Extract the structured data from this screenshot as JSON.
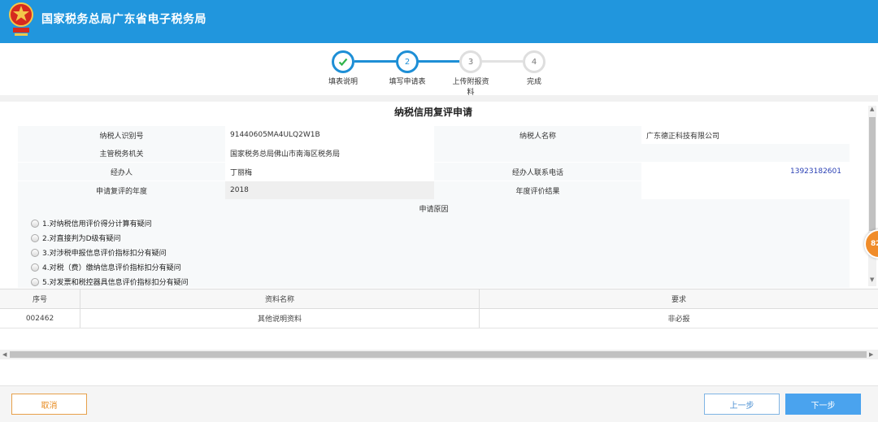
{
  "header": {
    "title": "国家税务总局广东省电子税务局",
    "emblem_icon": "tax-emblem-icon"
  },
  "stepper": {
    "steps": [
      {
        "number": "✓",
        "label": "填表说明",
        "state": "done"
      },
      {
        "number": "2",
        "label": "填写申请表",
        "state": "active"
      },
      {
        "number": "3",
        "label": "上传附报资料",
        "state": "pending"
      },
      {
        "number": "4",
        "label": "完成",
        "state": "pending"
      }
    ]
  },
  "form": {
    "title": "纳税信用复评申请",
    "taxpayer_id_label": "纳税人识别号",
    "taxpayer_id_value": "91440605MA4ULQ2W1B",
    "taxpayer_name_label": "纳税人名称",
    "taxpayer_name_value": "广东德正科技有限公司",
    "authority_label": "主管税务机关",
    "authority_value": "国家税务总局佛山市南海区税务局",
    "handler_label": "经办人",
    "handler_value": "丁丽梅",
    "handler_phone_label": "经办人联系电话",
    "handler_phone_value": "13923182601",
    "year_label": "申请复评的年度",
    "year_value": "2018",
    "result_label": "年度评价结果",
    "result_value": "",
    "reason_label": "申请原因",
    "reasons": [
      "1.对纳税信用评价得分计算有疑问",
      "2.对直接判为D级有疑问",
      "3.对涉税申报信息评价指标扣分有疑问",
      "4.对税（费）缴纳信息评价指标扣分有疑问",
      "5.对发票和税控器具信息评价指标扣分有疑问"
    ]
  },
  "badge": {
    "text": "82"
  },
  "table": {
    "headers": [
      "序号",
      "资料名称",
      "要求"
    ],
    "rows": [
      [
        "002462",
        "其他说明资料",
        "非必报"
      ]
    ]
  },
  "footer": {
    "cancel": "取消",
    "prev": "上一步",
    "next": "下一步"
  },
  "colors": {
    "header": "#2196dd",
    "accent": "#1e8fd6",
    "cancel": "#e78a1e",
    "next": "#4aa3ee",
    "phone": "#2b41b5"
  }
}
